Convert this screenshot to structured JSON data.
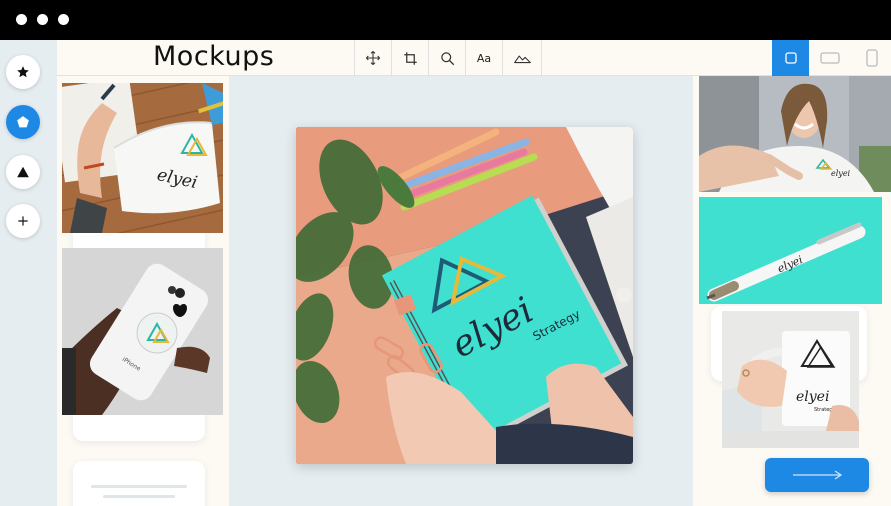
{
  "app": {
    "title": "Mockups"
  },
  "toolbar": {
    "tools": [
      "move-icon",
      "crop-icon",
      "search-icon",
      "text-icon",
      "landscape-icon"
    ],
    "text_tool_label": "Aa"
  },
  "brand": {
    "name": "elyei",
    "tagline": "Strategy",
    "phone_label": "iPhone"
  },
  "colors": {
    "accent": "#1e88e5",
    "mint": "#3fe0cf",
    "titlebar": "#000000",
    "canvas": "#e5edf1"
  }
}
